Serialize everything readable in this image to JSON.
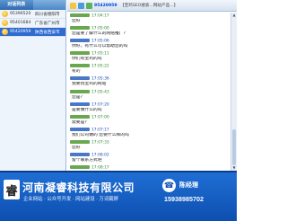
{
  "left_panel": {
    "tabs": [
      "对话列表",
      ""
    ],
    "contacts": [
      {
        "id": "95396520",
        "location": "四川省德阳市",
        "selected": false
      },
      {
        "id": "95401684",
        "location": "广东省广州市",
        "selected": false
      },
      {
        "id": "95420959",
        "location": "陕西省西安市",
        "selected": true
      }
    ]
  },
  "chat": {
    "visitor_id": "95420959",
    "title_meta": "【宝鸡SEO搜索...网站产品...】",
    "messages": [
      {
        "role": "agent",
        "time": "17:04:17",
        "text": "您好"
      },
      {
        "role": "agent",
        "time": "17:05:00",
        "text": "您是要了解什么的网络推广?"
      },
      {
        "role": "visitor",
        "time": "17:05:06",
        "text": "你好，有什么可以帮助您的吗"
      },
      {
        "role": "agent",
        "time": "17:05:11",
        "text": "你们有宝鸡的吗"
      },
      {
        "role": "agent",
        "time": "17:05:22",
        "text": "有的"
      },
      {
        "role": "visitor",
        "time": "17:05:36",
        "text": "我要找宝鸡的网站"
      },
      {
        "role": "agent",
        "time": "17:05:43",
        "text": "您是?"
      },
      {
        "role": "visitor",
        "time": "17:07:20",
        "text": "是要做什么的吗"
      },
      {
        "role": "agent",
        "time": "17:07:00",
        "text": "需要是?"
      },
      {
        "role": "visitor",
        "time": "17:07:17",
        "text": "我们公司做的 您要什么样的吗"
      },
      {
        "role": "agent",
        "time": "17:07:33",
        "text": "您好"
      },
      {
        "role": "visitor",
        "time": "17:08:02",
        "text": "留个联系方式吧"
      },
      {
        "role": "agent",
        "time": "17:08:17",
        "text": "我是网站就是的"
      },
      {
        "role": "visitor",
        "time": "17:08:30",
        "text": "您好"
      }
    ]
  },
  "banner": {
    "logo_glyph": "睿",
    "company": "河南凝睿科技有限公司",
    "slogan": "企业网站 · 公众号开发 · 网站建设 · 万词霸屏",
    "contact_label": "陈经理",
    "phone": "15938985702",
    "colors": {
      "primary": "#1f6ed4",
      "dark": "#0b3f8f"
    }
  }
}
